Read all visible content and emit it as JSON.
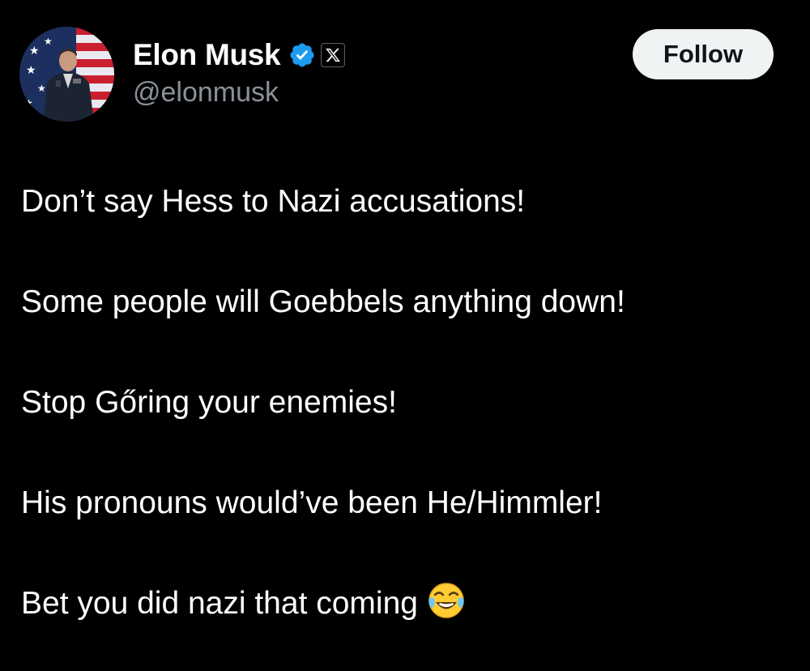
{
  "author": {
    "display_name": "Elon Musk",
    "handle": "@elonmusk",
    "verified_icon": "verified-badge-icon",
    "affiliate_icon": "x-logo-icon"
  },
  "actions": {
    "follow_label": "Follow"
  },
  "tweet": {
    "lines": [
      "Don’t say Hess to Nazi accusations!",
      "Some people will Goebbels anything down!",
      "Stop Gőring your enemies!",
      "His pronouns would’ve been He/Himmler!",
      "Bet you did nazi that coming"
    ],
    "trailing_emoji": "face-with-tears-of-joy"
  },
  "colors": {
    "background": "#000000",
    "text": "#ffffff",
    "handle": "#8b9199",
    "verified": "#1d9bf0",
    "follow_bg": "#eff3f4",
    "follow_text": "#0f1419"
  }
}
